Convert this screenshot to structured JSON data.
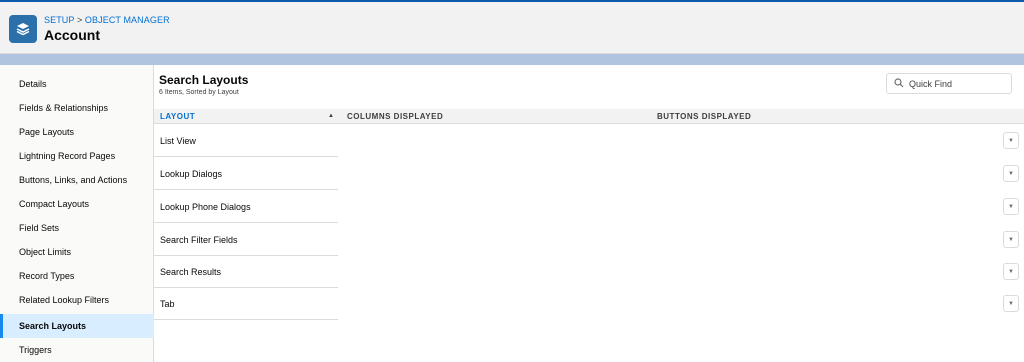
{
  "breadcrumb": {
    "setup": "SETUP",
    "separator": ">",
    "object_manager": "OBJECT MANAGER"
  },
  "header": {
    "title": "Account",
    "icon": "layers-icon"
  },
  "sidebar": {
    "items": [
      {
        "label": "Details"
      },
      {
        "label": "Fields & Relationships"
      },
      {
        "label": "Page Layouts"
      },
      {
        "label": "Lightning Record Pages"
      },
      {
        "label": "Buttons, Links, and Actions"
      },
      {
        "label": "Compact Layouts"
      },
      {
        "label": "Field Sets"
      },
      {
        "label": "Object Limits"
      },
      {
        "label": "Record Types"
      },
      {
        "label": "Related Lookup Filters"
      },
      {
        "label": "Search Layouts"
      },
      {
        "label": "Triggers"
      }
    ],
    "active": "Search Layouts"
  },
  "main": {
    "title": "Search Layouts",
    "subtitle": "6 Items, Sorted by Layout",
    "search": {
      "placeholder": "Quick Find",
      "value": "",
      "icon": "search-icon"
    },
    "table": {
      "columns": [
        "LAYOUT",
        "COLUMNS DISPLAYED",
        "BUTTONS DISPLAYED"
      ],
      "sort_indicator": "▲",
      "rows": [
        {
          "layout": "List View",
          "columns": "",
          "buttons": ""
        },
        {
          "layout": "Lookup Dialogs",
          "columns": "",
          "buttons": ""
        },
        {
          "layout": "Lookup Phone Dialogs",
          "columns": "",
          "buttons": ""
        },
        {
          "layout": "Search Filter Fields",
          "columns": "",
          "buttons": ""
        },
        {
          "layout": "Search Results",
          "columns": "",
          "buttons": ""
        },
        {
          "layout": "Tab",
          "columns": "",
          "buttons": ""
        }
      ],
      "row_action_icon": "caret-down-icon",
      "row_action_glyph": "▼"
    }
  },
  "colors": {
    "brand": "#0070d2",
    "header_bg": "#f3f2f2",
    "active_bg": "#d8edff",
    "band": "#b0c4df"
  }
}
